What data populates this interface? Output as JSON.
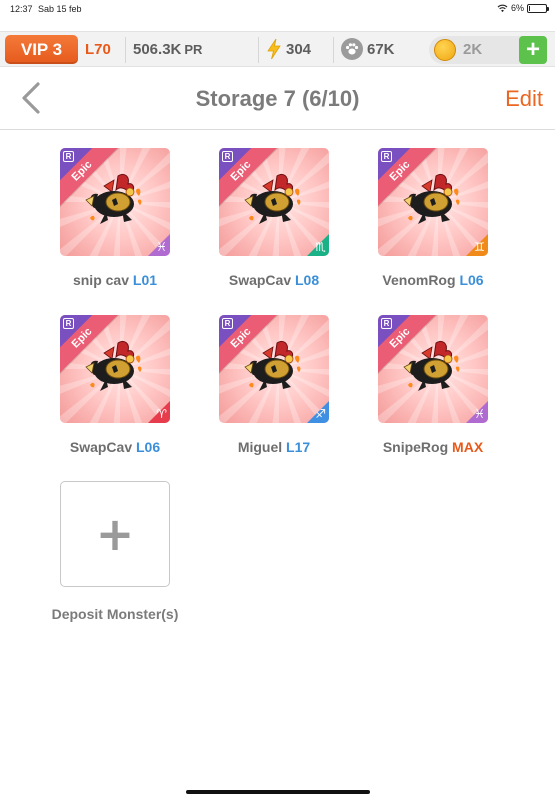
{
  "status_bar": {
    "time": "12:37",
    "date": "Sab 15 feb",
    "battery": "6%",
    "battery_level": 0.06
  },
  "resources": {
    "vip": "VIP 3",
    "level": "L70",
    "power": "506.3K",
    "power_unit": "PR",
    "energy": "304",
    "food": "67K",
    "gold": "2K",
    "add_label": "+"
  },
  "header": {
    "title": "Storage 7 (6/10)",
    "edit_label": "Edit"
  },
  "monsters": [
    {
      "name": "snip cav",
      "level": "L01",
      "rarity": "Epic",
      "rank": "R",
      "element": "pisces",
      "element_glyph": "♓",
      "element_color": "#b06bd1"
    },
    {
      "name": "SwapCav",
      "level": "L08",
      "rarity": "Epic",
      "rank": "R",
      "element": "scorpio",
      "element_glyph": "♏",
      "element_color": "#1bb187"
    },
    {
      "name": "VenomRog",
      "level": "L06",
      "rarity": "Epic",
      "rank": "R",
      "element": "gemini",
      "element_glyph": "♊",
      "element_color": "#f08a1a"
    },
    {
      "name": "SwapCav",
      "level": "L06",
      "rarity": "Epic",
      "rank": "R",
      "element": "aries",
      "element_glyph": "♈",
      "element_color": "#e63c4c"
    },
    {
      "name": "Miguel",
      "level": "L17",
      "rarity": "Epic",
      "rank": "R",
      "element": "sagittarius",
      "element_glyph": "♐",
      "element_color": "#3f8fe2"
    },
    {
      "name": "SnipeRog",
      "level": "MAX",
      "rarity": "Epic",
      "rank": "R",
      "element": "pisces",
      "element_glyph": "♓",
      "element_color": "#b06bd1"
    }
  ],
  "deposit": {
    "icon": "+",
    "label": "Deposit Monster(s)"
  },
  "colors": {
    "accent_orange": "#ea6622",
    "level_blue": "#3b8fd9",
    "card_pink": "#ffc7c5",
    "epic_ribbon": "#eb5d74",
    "rank_purple": "#7a4fbf"
  }
}
